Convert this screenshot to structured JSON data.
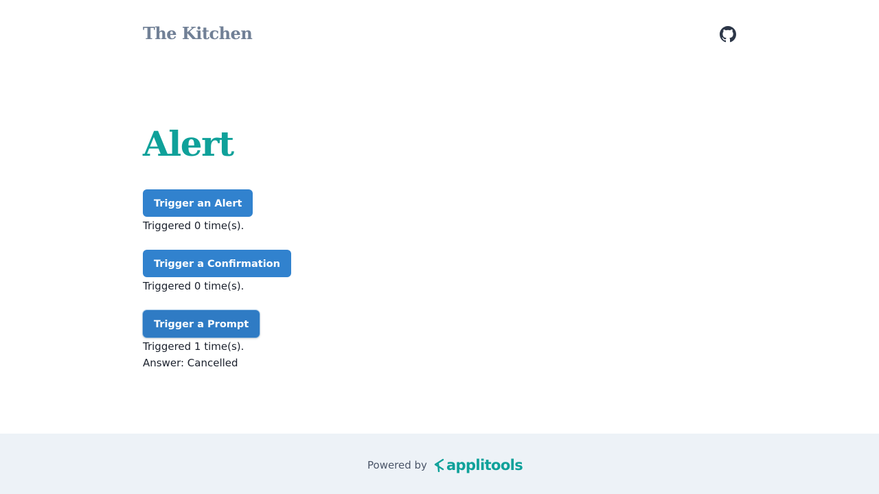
{
  "header": {
    "brand": "The Kitchen",
    "github_icon": "github-icon"
  },
  "main": {
    "title": "Alert",
    "sections": [
      {
        "button_label": "Trigger an Alert",
        "count_text": "Triggered 0 time(s)."
      },
      {
        "button_label": "Trigger a Confirmation",
        "count_text": "Triggered 0 time(s)."
      },
      {
        "button_label": "Trigger a Prompt",
        "count_text": "Triggered 1 time(s).",
        "answer_text": "Answer: Cancelled"
      }
    ]
  },
  "footer": {
    "powered_by": "Powered by",
    "logo_text": "applitools",
    "logo_icon": "applitools-logo-icon"
  },
  "colors": {
    "brand_gray": "#718096",
    "title_teal": "#0fa19a",
    "button_blue": "#3182ce",
    "footer_bg": "#edf2f7"
  }
}
